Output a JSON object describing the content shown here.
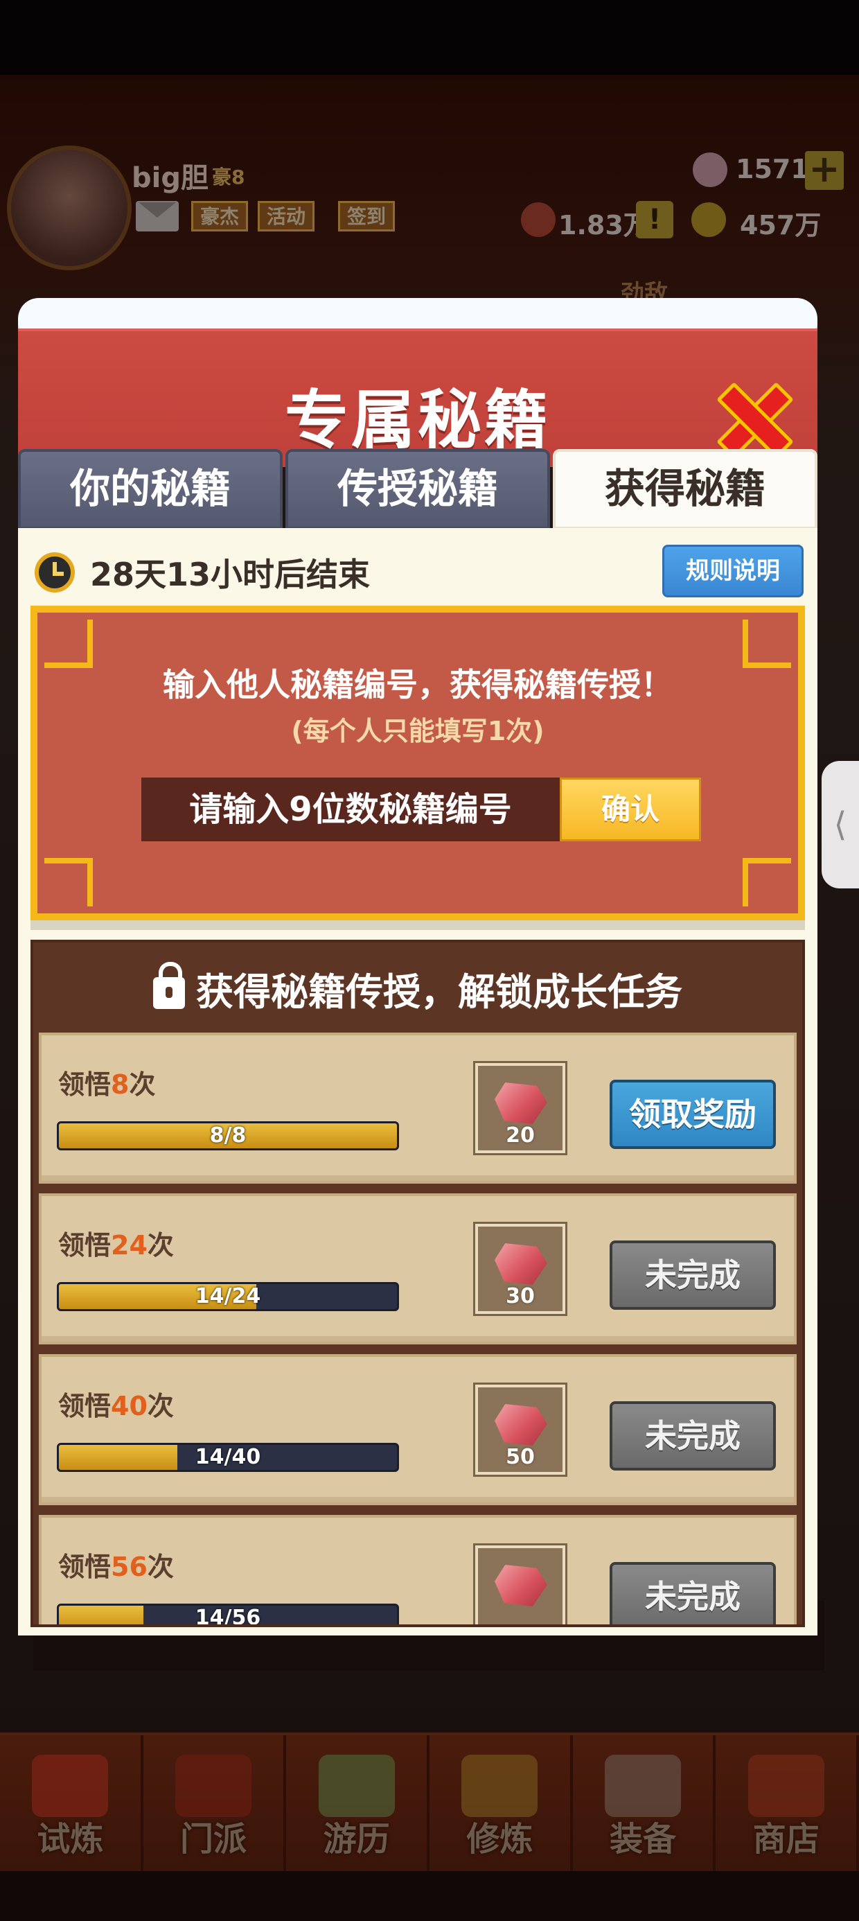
{
  "top_bar": {
    "player_name": "big胆",
    "player_rank": "豪8",
    "tags": [
      "豪杰",
      "活动",
      "签到"
    ],
    "gems": "1571",
    "power": "1.83万",
    "gold": "457万",
    "enemy_label": "劲敌"
  },
  "modal": {
    "title": "专属秘籍",
    "tabs": [
      {
        "label": "你的秘籍",
        "active": false
      },
      {
        "label": "传授秘籍",
        "active": false
      },
      {
        "label": "获得秘籍",
        "active": true
      }
    ],
    "timer_text": "28天13小时后结束",
    "rules_button": "规则说明",
    "code_panel": {
      "title": "输入他人秘籍编号，获得秘籍传授！",
      "subtitle": "(每个人只能填写1次)",
      "input_placeholder": "请输入9位数秘籍编号",
      "confirm_button": "确认"
    },
    "tasks_title": "获得秘籍传授，解锁成长任务",
    "tasks": [
      {
        "label_prefix": "领悟",
        "count": "8",
        "label_suffix": "次",
        "progress_text": "8/8",
        "progress": 1.0,
        "reward": "20",
        "button": "领取奖励",
        "status": "claim"
      },
      {
        "label_prefix": "领悟",
        "count": "24",
        "label_suffix": "次",
        "progress_text": "14/24",
        "progress": 0.583,
        "reward": "30",
        "button": "未完成",
        "status": "pending"
      },
      {
        "label_prefix": "领悟",
        "count": "40",
        "label_suffix": "次",
        "progress_text": "14/40",
        "progress": 0.35,
        "reward": "50",
        "button": "未完成",
        "status": "pending"
      },
      {
        "label_prefix": "领悟",
        "count": "56",
        "label_suffix": "次",
        "progress_text": "14/56",
        "progress": 0.25,
        "reward": "",
        "button": "未完成",
        "status": "pending"
      }
    ]
  },
  "bottom_nav": [
    {
      "label": "试炼",
      "icon": "scroll-icon"
    },
    {
      "label": "门派",
      "icon": "gate-icon"
    },
    {
      "label": "游历",
      "icon": "mountain-icon"
    },
    {
      "label": "修炼",
      "icon": "book-icon"
    },
    {
      "label": "装备",
      "icon": "sword-icon"
    },
    {
      "label": "商店",
      "icon": "shop-icon"
    }
  ],
  "colors": {
    "header_red": "#c0413a",
    "gold_border": "#f5b819",
    "claim_blue": "#2f87c4",
    "highlight_orange": "#e1601d"
  }
}
